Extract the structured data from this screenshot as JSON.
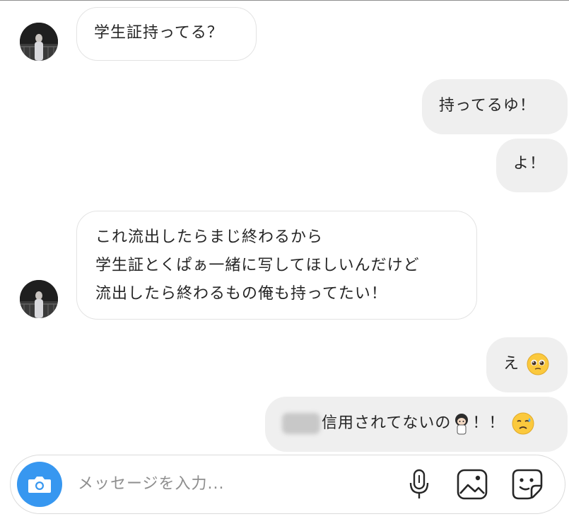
{
  "conversation": {
    "messages": [
      {
        "id": "m1",
        "side": "in",
        "text": "学生証持ってる？"
      },
      {
        "id": "m2",
        "side": "out",
        "text": "持ってるゆ！"
      },
      {
        "id": "m3",
        "side": "out",
        "text": "よ！"
      },
      {
        "id": "m4",
        "side": "in",
        "lines": [
          "これ流出したらまじ終わるから",
          "学生証とくぱぁ一緒に写してほしいんだけど",
          "流出したら終わるもの俺も持ってたい！"
        ]
      },
      {
        "id": "m5",
        "side": "out",
        "text": "え",
        "emoji": "pleading-face"
      },
      {
        "id": "m6",
        "side": "out",
        "text": "信用されてないの",
        "text_tail": "！！",
        "emoji": "sad-relieved-face"
      }
    ]
  },
  "composer": {
    "placeholder": "メッセージを入力..."
  },
  "icons": {
    "camera": "camera-icon",
    "mic": "microphone-icon",
    "gallery": "image-icon",
    "sticker": "sticker-icon"
  },
  "colors": {
    "accent": "#3797f0",
    "outgoing_bubble": "#efefef",
    "incoming_border": "#e3e3e3",
    "placeholder": "#8e8e8e"
  }
}
